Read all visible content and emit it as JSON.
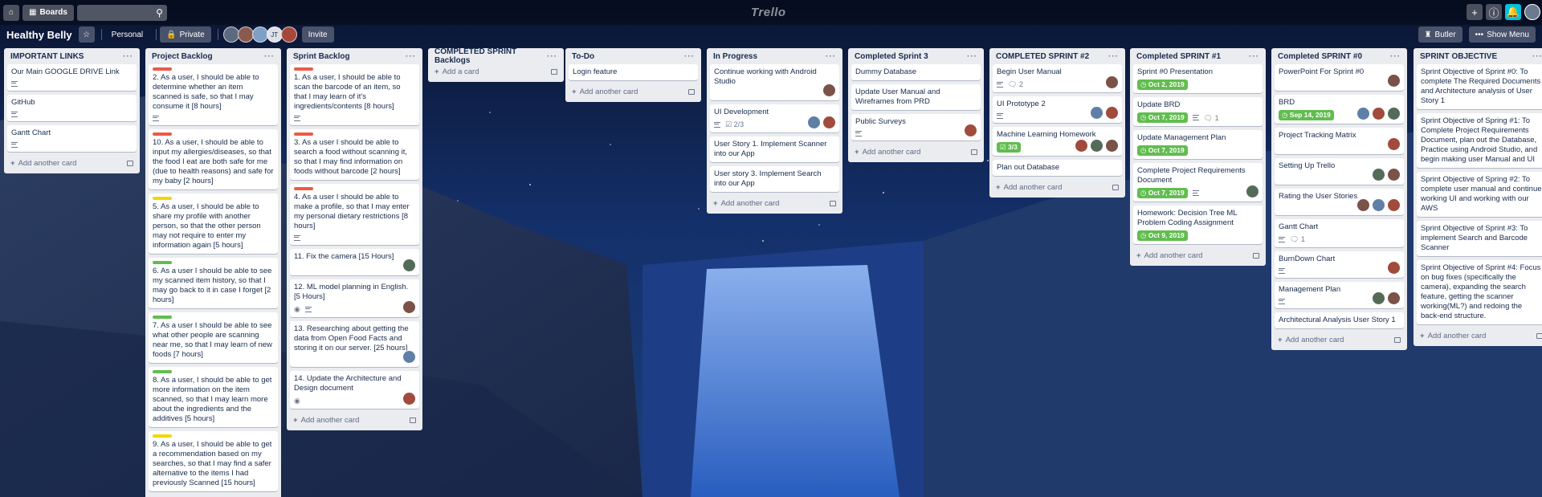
{
  "topbar": {
    "boards_label": "Boards",
    "logo": "Trello"
  },
  "board": {
    "title": "Healthy Belly",
    "personal_label": "Personal",
    "private_label": "Private",
    "invite_label": "Invite",
    "member_initials": "JT",
    "butler_label": "Butler",
    "show_menu_label": "Show Menu"
  },
  "colors": {
    "red_label": "#eb5a46",
    "yellow_label": "#f2d600",
    "green_label": "#61bd4f",
    "list_bg": "#ebecf0",
    "due_complete": "#61bd4f"
  },
  "add_card_label": "Add another card",
  "add_a_card_label": "Add a card",
  "lists": [
    {
      "title": "IMPORTANT LINKS",
      "cards": [
        {
          "title": "Our Main GOOGLE DRIVE Link",
          "desc": true
        },
        {
          "title": "GitHub",
          "desc": true
        },
        {
          "title": "Gantt Chart",
          "desc": true
        }
      ]
    },
    {
      "title": "Project Backlog",
      "cards": [
        {
          "label": "red",
          "title": "2. As a user, I should be able to determine whether an item scanned is safe, so that I may consume it [8 hours]",
          "desc": true
        },
        {
          "label": "red",
          "title": "10. As a user, I should be able to input my allergies/diseases, so that the food I eat are both safe for me (due to health reasons) and safe for my baby [2 hours]"
        },
        {
          "label": "yellow",
          "title": "5. As a user, I should be able to share my profile with another person, so that the other person may not require to enter my information again [5 hours]"
        },
        {
          "label": "green",
          "title": "6. As a user I should be able to see my scanned item history, so that I may go back to it in case I forget [2 hours]"
        },
        {
          "label": "green",
          "title": "7. As a user I should be able to see what other people are scanning near me, so that I may learn of new foods [7 hours]"
        },
        {
          "label": "green",
          "title": "8. As a user, I should be able to get more information on the item scanned, so that I may learn more about the ingredients and the additives [5 hours]"
        },
        {
          "label": "yellow",
          "title": "9. As a user, I should be able to get a recommendation based on my searches, so that I may find a safer alternative to the items I had previously Scanned [15 hours]"
        }
      ]
    },
    {
      "title": "Sprint Backlog",
      "cards": [
        {
          "label": "red",
          "title": "1. As a user, I should be able to scan the barcode of an item, so that I may learn of it's ingredients/contents [8 hours]",
          "desc": true
        },
        {
          "label": "red",
          "title": "3. As a user I should be able to search a food without scanning it, so that I may find information on foods without barcode [2 hours]"
        },
        {
          "label": "red",
          "title": "4. As a user I should be able to make a profile, so that I may enter my personal dietary restrictions [8 hours]",
          "desc": true
        },
        {
          "title": "11. Fix the camera [15 Hours]",
          "members": 1
        },
        {
          "title": "12. ML model planning in English. [5 Hours]",
          "eye": true,
          "desc": true,
          "members": 1
        },
        {
          "title": "13. Researching about getting the data from Open Food Facts and storing it on our server. [25 hours]",
          "members": 1
        },
        {
          "title": "14. Update the Architecture and Design document",
          "eye": true,
          "members": 1
        }
      ]
    },
    {
      "title": "COMPLETED SPRINT Backlogs",
      "add_style": "a",
      "cards": []
    },
    {
      "title": "To-Do",
      "cards": [
        {
          "title": "Login feature"
        }
      ]
    },
    {
      "title": "In Progress",
      "cards": [
        {
          "title": "Continue working with Android Studio",
          "members": 1
        },
        {
          "title": "UI Development",
          "desc": true,
          "checklist": "2/3",
          "members": 2
        },
        {
          "title": "User Story 1. Implement Scanner into our App"
        },
        {
          "title": "User story 3. Implement Search into our App"
        }
      ]
    },
    {
      "title": "Completed Sprint 3",
      "cards": [
        {
          "title": "Dummy Database"
        },
        {
          "title": "Update User Manual and Wireframes from PRD"
        },
        {
          "title": "Public Surveys",
          "desc": true,
          "members": 1
        }
      ]
    },
    {
      "title": "COMPLETED SPRINT #2",
      "cards": [
        {
          "title": "Begin User Manual",
          "desc": true,
          "comments": "2",
          "members": 1
        },
        {
          "title": "UI Prototype 2",
          "desc": true,
          "members": 2
        },
        {
          "title": "Machine Learning Homework",
          "checklist_done": "3/3",
          "members": 3
        },
        {
          "title": "Plan out Database"
        }
      ]
    },
    {
      "title": "Completed SPRINT #1",
      "cards": [
        {
          "title": "Sprint #0 Presentation",
          "due": "Oct 2, 2019"
        },
        {
          "title": "Update BRD",
          "due": "Oct 7, 2019",
          "desc": true,
          "comments": "1"
        },
        {
          "title": "Update Management Plan",
          "due": "Oct 7, 2019"
        },
        {
          "title": "Complete Project Requirements Document",
          "due": "Oct 7, 2019",
          "desc": true,
          "members": 1
        },
        {
          "title": "Homework: Decision Tree ML Problem Coding Assignment",
          "due": "Oct 9, 2019"
        }
      ]
    },
    {
      "title": "Completed SPRINT #0",
      "cards": [
        {
          "title": "PowerPoint For Sprint #0",
          "members": 1
        },
        {
          "title": "BRD",
          "due": "Sep 14, 2019",
          "members": 3
        },
        {
          "title": "Project Tracking Matrix",
          "members": 1
        },
        {
          "title": "Setting Up Trello",
          "members": 2
        },
        {
          "title": "Rating the User Stories",
          "members": 3
        },
        {
          "title": "Gantt Chart",
          "desc": true,
          "comments": "1"
        },
        {
          "title": "BurnDown Chart",
          "desc": true,
          "members": 1
        },
        {
          "title": "Management Plan",
          "desc": true,
          "members": 2
        },
        {
          "title": "Architectural Analysis User Story 1"
        }
      ]
    },
    {
      "title": "SPRINT OBJECTIVE",
      "cards": [
        {
          "title": "Sprint Objective of Sprint #0: To complete The Required Documents and Architecture analysis of User Story 1"
        },
        {
          "title": "Sprint Objective of Spring #1: To Complete Project Requirements Document, plan out the Database, Practice using Android Studio, and begin making user Manual and UI"
        },
        {
          "title": "Sprint Objective of Spring #2: To complete user manual and continue working UI and working with our AWS"
        },
        {
          "title": "Sprint Objective of Sprint #3: To implement Search and Barcode Scanner"
        },
        {
          "title": "Sprint Objective of Sprint #4: Focus on bug fixes (specifically the camera), expanding the search feature, getting the scanner working(ML?) and redoing the back-end structure."
        }
      ]
    }
  ]
}
